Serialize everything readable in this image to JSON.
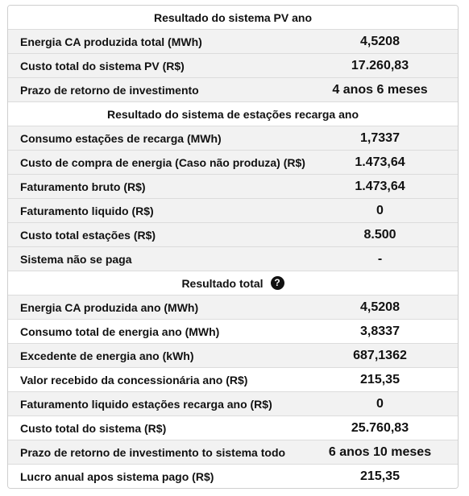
{
  "sections": [
    {
      "title": "Resultado do sistema PV ano",
      "rows": [
        {
          "label": "Energia CA produzida total (MWh)",
          "value": "4,5208"
        },
        {
          "label": "Custo total do sistema PV (R$)",
          "value": "17.260,83"
        },
        {
          "label": "Prazo de retorno de investimento",
          "value": "4 anos 6 meses"
        }
      ]
    },
    {
      "title": "Resultado do sistema de estações recarga ano",
      "rows": [
        {
          "label": "Consumo estações de recarga (MWh)",
          "value": "1,7337"
        },
        {
          "label": "Custo de compra de energia (Caso não produza) (R$)",
          "value": "1.473,64"
        },
        {
          "label": "Faturamento bruto (R$)",
          "value": "1.473,64"
        },
        {
          "label": "Faturamento liquido (R$)",
          "value": "0"
        },
        {
          "label": "Custo total estações (R$)",
          "value": "8.500"
        },
        {
          "label": "Sistema não se paga",
          "value": "-"
        }
      ]
    },
    {
      "title": "Resultado total",
      "help_icon": "question-circle-icon",
      "help_glyph": "?",
      "rows": [
        {
          "label": "Energia CA produzida ano (MWh)",
          "value": "4,5208"
        },
        {
          "label": "Consumo total de energia ano (MWh)",
          "value": "3,8337"
        },
        {
          "label": "Excedente de energia ano (kWh)",
          "value": "687,1362"
        },
        {
          "label": "Valor recebido da concessionária ano (R$)",
          "value": "215,35"
        },
        {
          "label": "Faturamento liquido estações recarga ano (R$)",
          "value": "0"
        },
        {
          "label": "Custo total do sistema (R$)",
          "value": "25.760,83"
        },
        {
          "label": "Prazo de retorno de investimento to sistema todo",
          "value": "6 anos 10 meses"
        },
        {
          "label": "Lucro anual apos sistema pago (R$)",
          "value": "215,35"
        }
      ]
    }
  ],
  "colors": {
    "row_stripe": "#f2f2f2",
    "border": "#dcdcdc",
    "text": "#111111"
  }
}
